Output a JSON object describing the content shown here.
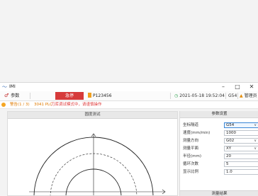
{
  "window": {
    "title": "IMI",
    "icon": "wave-app-icon",
    "controls": [
      "–",
      "□",
      "✕"
    ]
  },
  "toolbar": {
    "param_label": "参数",
    "stop_label": "急停",
    "order_label": "P123456",
    "datetime": "2021-05-18 19:52:04",
    "coord": "G54",
    "user": "管理员"
  },
  "alarm": {
    "count": "警告(1 / 3)",
    "code": "3041  PLC",
    "message": "刀库调试模式中，请谨慎操作"
  },
  "left_panel": {
    "title": "圆度测试"
  },
  "right_panel": {
    "title": "参数设置",
    "fields": [
      {
        "label": "坐标隔道",
        "value": "G54",
        "dropdown": true,
        "selected": true
      },
      {
        "label": "速度(mm/min)",
        "value": "1000",
        "dropdown": false
      },
      {
        "label": "测量方向",
        "value": "G02",
        "dropdown": true
      },
      {
        "label": "测量平面",
        "value": "XY",
        "dropdown": true
      },
      {
        "label": "半径(mm)",
        "value": "20",
        "dropdown": false
      },
      {
        "label": "循环次数",
        "value": "5",
        "dropdown": false
      },
      {
        "label": "显示比例",
        "value": "1.0",
        "dropdown": false
      }
    ],
    "footer": "测量结果"
  },
  "colors": {
    "stop": "#d63a3a",
    "accent": "#3a86d6",
    "warning": "#e07a00"
  }
}
